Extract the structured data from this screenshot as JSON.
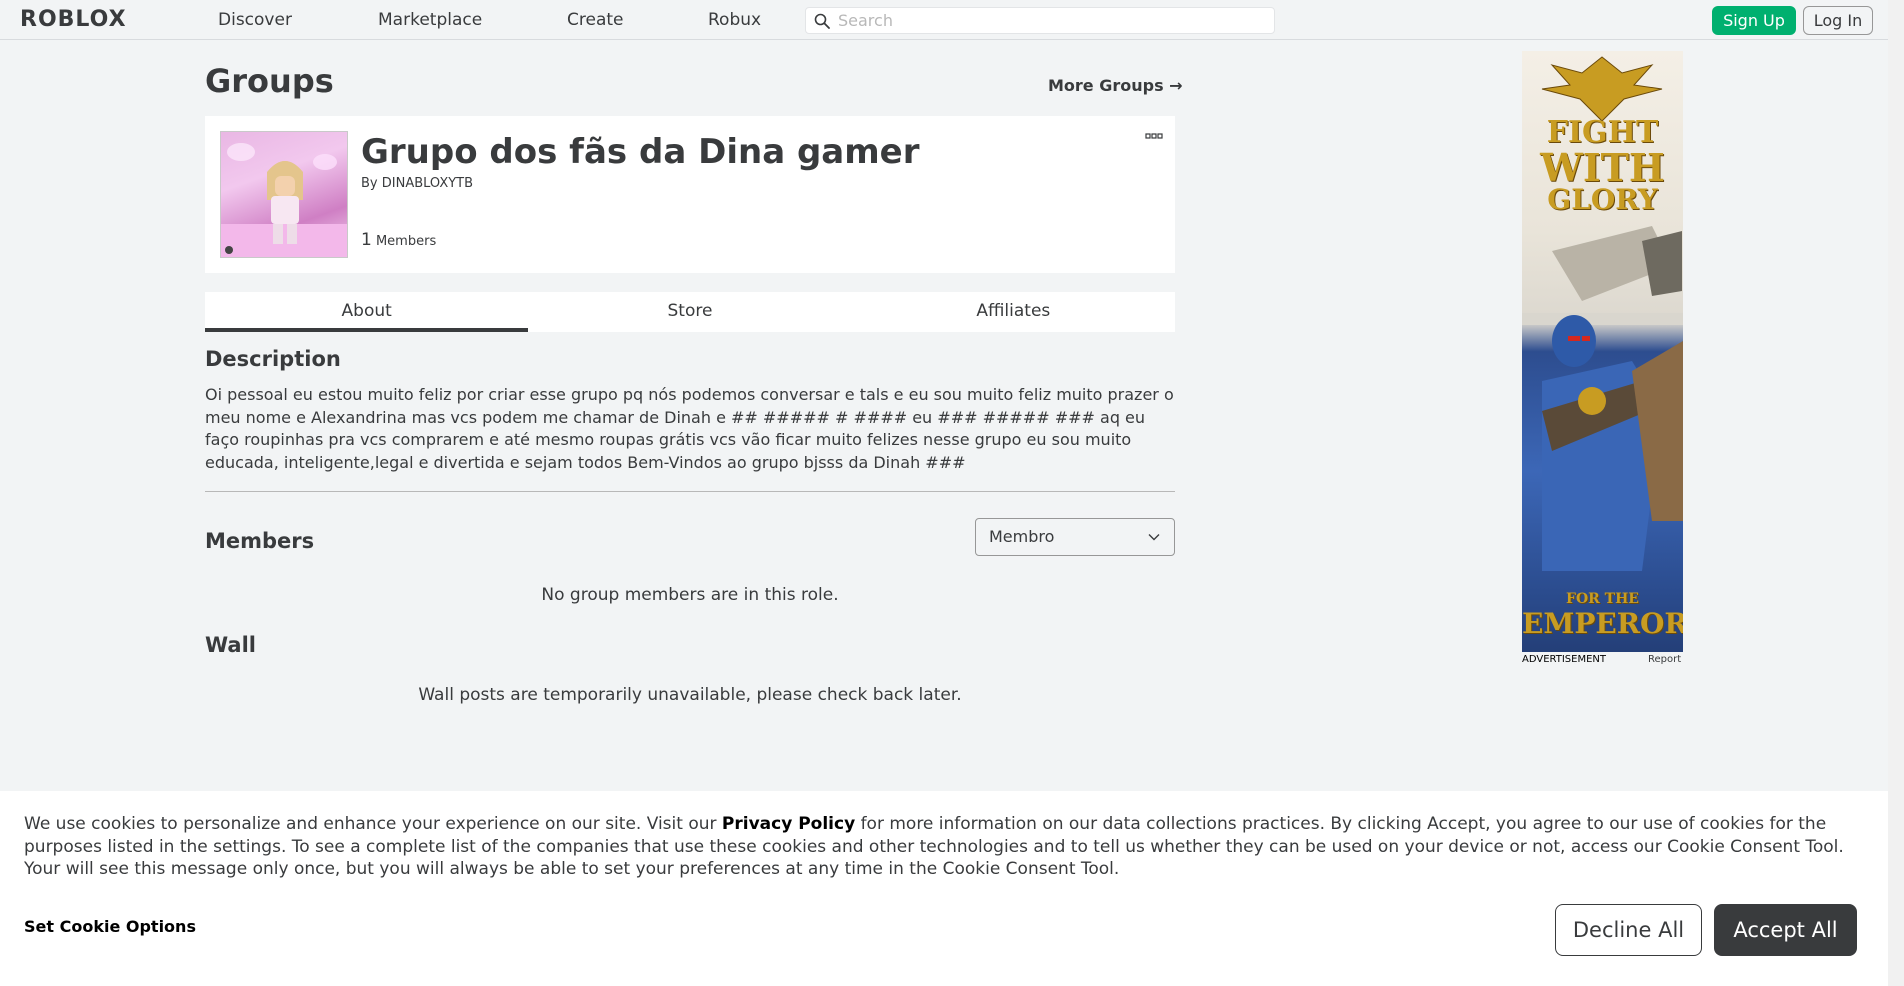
{
  "header": {
    "logo_text": "ROBLOX",
    "nav": [
      "Discover",
      "Marketplace",
      "Create",
      "Robux"
    ],
    "search_placeholder": "Search",
    "signup_label": "Sign Up",
    "login_label": "Log In"
  },
  "page": {
    "title": "Groups",
    "more_groups": "More Groups →"
  },
  "group": {
    "name": "Grupo dos fãs da Dina gamer",
    "by_label": "By",
    "owner": "DINABLOXYTB",
    "member_count": "1",
    "members_label": "Members"
  },
  "tabs": [
    "About",
    "Store",
    "Affiliates"
  ],
  "about": {
    "description_title": "Description",
    "description": "Oi pessoal eu estou muito feliz por criar esse grupo pq nós podemos conversar e tals e eu sou muito feliz muito prazer o meu nome e Alexandrina mas vcs podem me chamar de Dinah e ## ##### # #### eu ### ##### ### aq eu faço roupinhas pra vcs comprarem e até mesmo roupas grátis vcs vão ficar muito felizes nesse grupo eu sou muito educada, inteligente,legal e divertida e sejam todos Bem-Vindos ao grupo bjsss da Dinah ###",
    "members_title": "Members",
    "role_selected": "Membro",
    "members_empty": "No group members are in this role.",
    "wall_title": "Wall",
    "wall_empty": "Wall posts are temporarily unavailable, please check back later."
  },
  "ad": {
    "line1": "FIGHT",
    "line2": "WITH",
    "line3": "GLORY",
    "line4": "FOR THE",
    "line5": "EMPEROR",
    "label": "ADVERTISEMENT",
    "report": "Report"
  },
  "cookie": {
    "text_before": "We use cookies to personalize and enhance your experience on our site. Visit our ",
    "privacy_link": "Privacy Policy",
    "text_after": " for more information on our data collections practices. By clicking Accept, you agree to our use of cookies for the purposes listed in the settings. To see a complete list of the companies that use these cookies and other technologies and to tell us whether they can be used on your device or not, access our Cookie Consent Tool. Your will see this message only once, but you will always be able to set your preferences at any time in the Cookie Consent Tool.",
    "options_label": "Set Cookie Options",
    "decline_label": "Decline All",
    "accept_label": "Accept All"
  },
  "colors": {
    "signup_green": "#00b06f",
    "text_dark": "#393b3d",
    "background": "#f2f4f5"
  }
}
